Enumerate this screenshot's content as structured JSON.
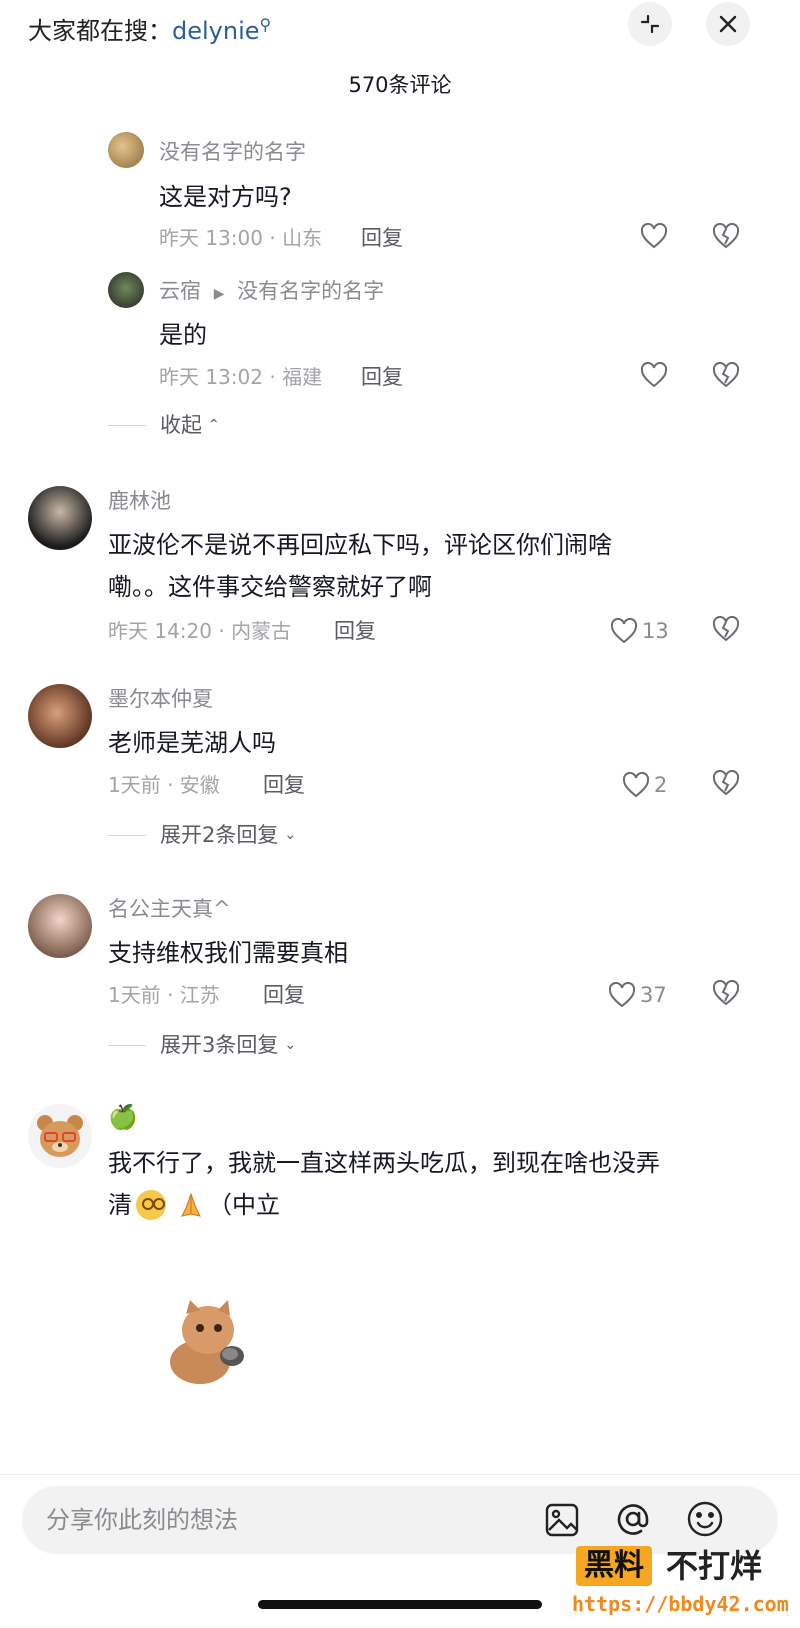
{
  "header": {
    "search_prefix": "大家都在搜：",
    "search_keyword": "delynie",
    "title": "570条评论"
  },
  "comments": [
    {
      "name": "没有名字的名字",
      "text": "这是对方吗?",
      "meta": "昨天 13:00 · 山东",
      "reply": "回复"
    },
    {
      "name": "云宿",
      "reply_to": "没有名字的名字",
      "text": "是的",
      "meta": "昨天 13:02 · 福建",
      "reply": "回复"
    },
    {
      "collapse": "收起"
    },
    {
      "name": "鹿林池",
      "text_line1": "亚波伦不是说不再回应私下吗，评论区你们闹啥",
      "text_line2": "嘞。。这件事交给警察就好了啊",
      "meta": "昨天 14:20 · 内蒙古",
      "reply": "回复",
      "likes": "13"
    },
    {
      "name": "墨尔本仲夏",
      "text": "老师是芜湖人吗",
      "meta": "1天前 · 安徽",
      "reply": "回复",
      "likes": "2",
      "expand": "展开2条回复"
    },
    {
      "name": "名公主天真^",
      "text": "支持维权我们需要真相",
      "meta": "1天前 · 江苏",
      "reply": "回复",
      "likes": "37",
      "expand": "展开3条回复"
    },
    {
      "name": "🍏",
      "text_line1": "我不行了，我就一直这样两头吃瓜，到现在啥也没弄",
      "text_line2_prefix": "清",
      "text_line2_suffix": "（中立"
    }
  ],
  "input": {
    "placeholder": "分享你此刻的想法"
  },
  "watermark": {
    "brand_a": "黑料",
    "brand_b": "不打烊",
    "url": "https://bbdy42.com"
  }
}
